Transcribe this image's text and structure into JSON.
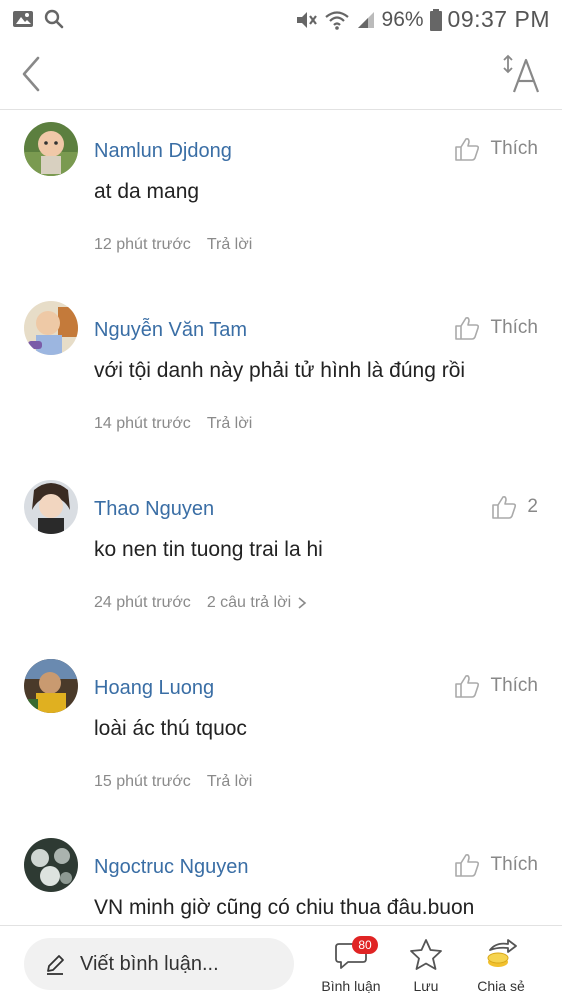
{
  "status_bar": {
    "battery": "96%",
    "time": "09:37 PM"
  },
  "comments": [
    {
      "author": "Namlun Djdong",
      "text": "at da mang",
      "time": "12 phút trước",
      "reply": "Trả lời",
      "like_label": "Thích"
    },
    {
      "author": "Nguyễn Văn Tam",
      "text": "với tội danh này phải tử hình là đúng rồi",
      "time": "14 phút trước",
      "reply": "Trả lời",
      "like_label": "Thích"
    },
    {
      "author": "Thao Nguyen",
      "text": "ko nen tin tuong trai la hi",
      "time": "24 phút trước",
      "reply": "2 câu trả lời",
      "like_label": "2"
    },
    {
      "author": "Hoang Luong",
      "text": "loài ác thú tquoc",
      "time": "15 phút trước",
      "reply": "Trả lời",
      "like_label": "Thích"
    },
    {
      "author": "Ngoctruc Nguyen",
      "text": "VN minh giờ cũng có chiu thua đâu.buon",
      "time": "",
      "reply": "",
      "like_label": "Thích"
    }
  ],
  "bottom_bar": {
    "write_placeholder": "Viết bình luận...",
    "comments_label": "Bình luận",
    "comments_badge": "80",
    "save_label": "Lưu",
    "share_label": "Chia sẻ"
  },
  "colors": {
    "author": "#3a6ea5",
    "badge": "#e02424",
    "share_coin": "#f2c12e"
  }
}
